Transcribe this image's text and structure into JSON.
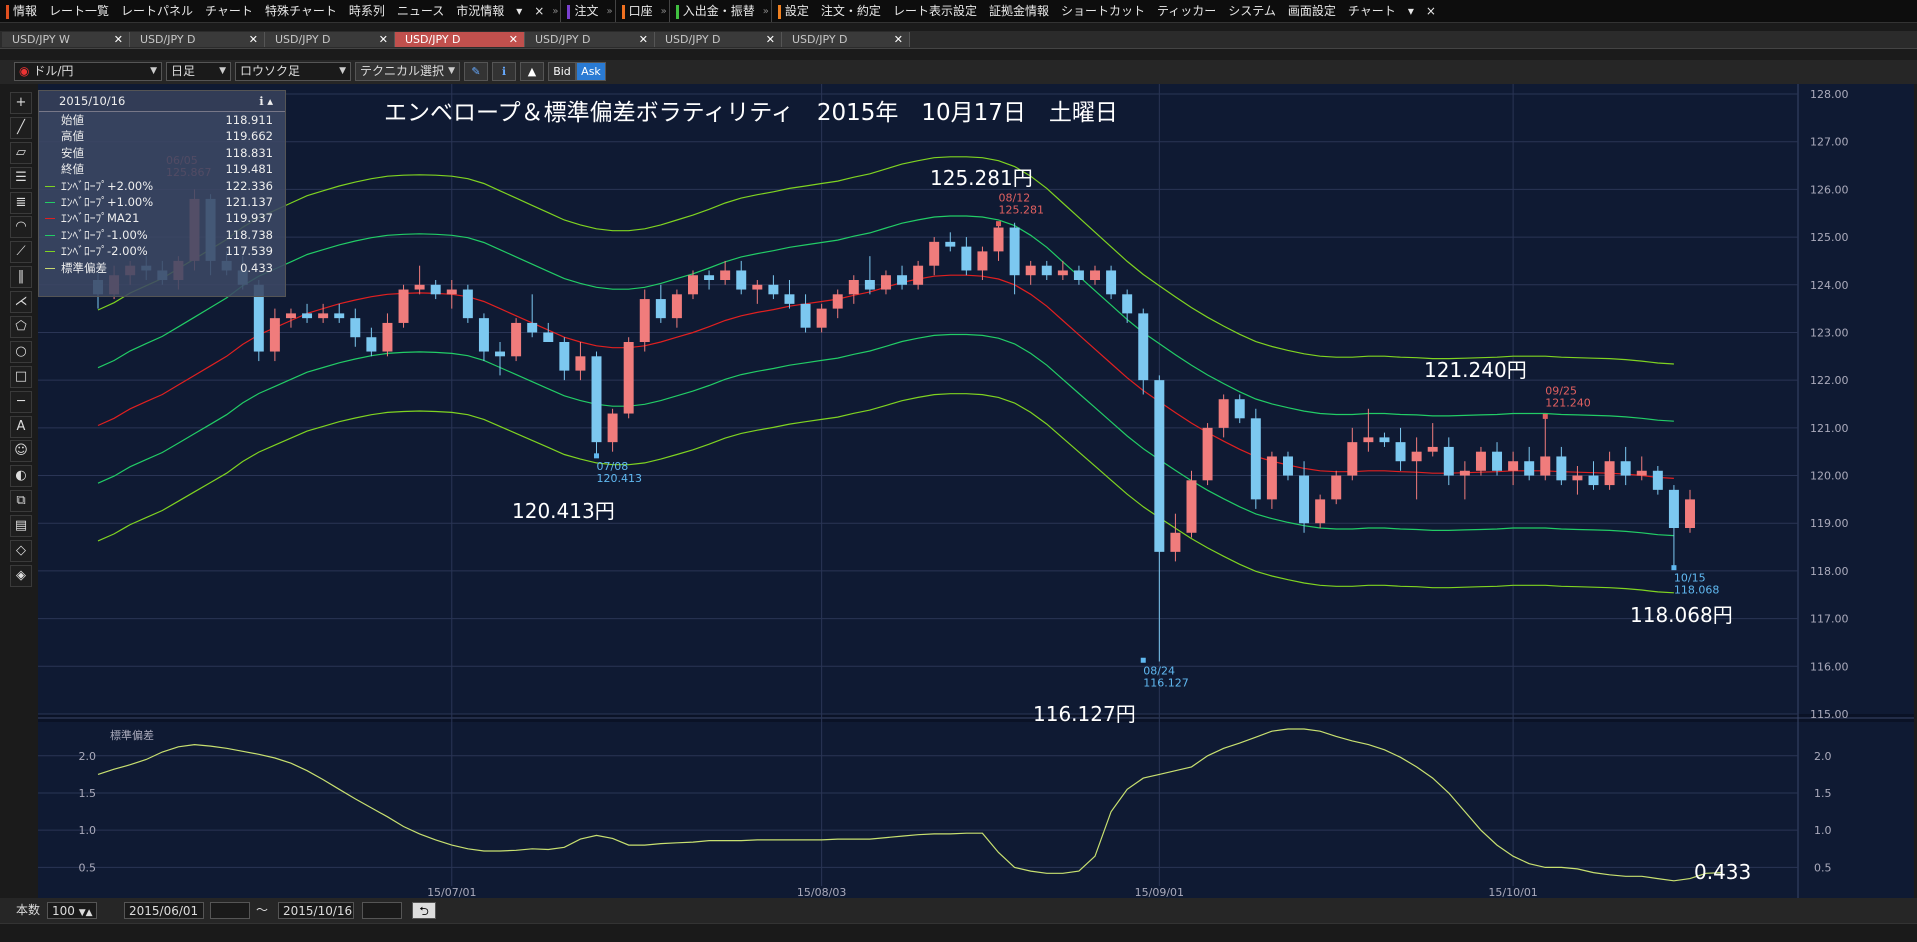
{
  "menu": {
    "items_a": [
      "情報",
      "レート一覧",
      "レートパネル",
      "チャート",
      "特殊チャート",
      "時系列",
      "ニュース",
      "市況情報"
    ],
    "order": "注文",
    "account": "口座",
    "deposit": "入出金・振替",
    "items_b": [
      "設定",
      "注文・約定",
      "レート表示設定",
      "証拠金情報",
      "ショートカット",
      "ティッカー",
      "システム",
      "画面設定",
      "チャート"
    ],
    "close": "×"
  },
  "tabs": [
    {
      "label": "USD/JPY W",
      "active": false
    },
    {
      "label": "USD/JPY D",
      "active": false
    },
    {
      "label": "USD/JPY D",
      "active": false
    },
    {
      "label": "USD/JPY D",
      "active": true
    },
    {
      "label": "USD/JPY D",
      "active": false
    },
    {
      "label": "USD/JPY D",
      "active": false
    },
    {
      "label": "USD/JPY D",
      "active": false
    }
  ],
  "toolbar": {
    "pair": "ドル/円",
    "period": "日足",
    "style": "ロウソク足",
    "technical": "テクニカル選択",
    "bid": "Bid",
    "ask": "Ask"
  },
  "info": {
    "date": "2015/10/16",
    "rows": [
      {
        "label": "始値",
        "value": "118.911",
        "color": ""
      },
      {
        "label": "高値",
        "value": "119.662",
        "color": ""
      },
      {
        "label": "安値",
        "value": "118.831",
        "color": ""
      },
      {
        "label": "終値",
        "value": "119.481",
        "color": ""
      },
      {
        "label": "ｴﾝﾍﾞﾛｰﾌﾟ+2.00%",
        "value": "122.336",
        "color": "#7fd321"
      },
      {
        "label": "ｴﾝﾍﾞﾛｰﾌﾟ+1.00%",
        "value": "121.137",
        "color": "#22cc66"
      },
      {
        "label": "ｴﾝﾍﾞﾛｰﾌﾟMA21",
        "value": "119.937",
        "color": "#e02020"
      },
      {
        "label": "ｴﾝﾍﾞﾛｰﾌﾟ-1.00%",
        "value": "118.738",
        "color": "#22cc66"
      },
      {
        "label": "ｴﾝﾍﾞﾛｰﾌﾟ-2.00%",
        "value": "117.539",
        "color": "#7fd321"
      },
      {
        "label": "標準偏差",
        "value": "0.433",
        "color": "#c8d870"
      }
    ]
  },
  "bottom": {
    "count_label": "本数",
    "count": "100",
    "from": "2015/06/01",
    "tilde": "～",
    "to": "2015/10/16"
  },
  "chart_data": {
    "type": "candlestick",
    "title": "エンベロープ＆標準偏差ボラティリティ　2015年　10月17日　土曜日",
    "ylim": [
      115,
      128
    ],
    "y_ticks": [
      "128.00",
      "127.00",
      "126.00",
      "125.00",
      "124.00",
      "123.00",
      "122.00",
      "121.00",
      "120.00",
      "119.00",
      "118.00",
      "117.00",
      "116.00",
      "115.00"
    ],
    "x_ticks": [
      "15/07/01",
      "15/08/03",
      "15/09/01",
      "15/10/01"
    ],
    "annotations": [
      {
        "text": "125.281円",
        "small_date": "08/12",
        "small_val": "125.281",
        "color": "#e06060"
      },
      {
        "text": "120.413円",
        "small_date": "07/08",
        "small_val": "120.413",
        "color": "#60b8f0"
      },
      {
        "text": "116.127円",
        "small_date": "08/24",
        "small_val": "116.127",
        "color": "#60b8f0"
      },
      {
        "text": "121.240円",
        "small_date": "09/25",
        "small_val": "121.240",
        "color": "#e06060"
      },
      {
        "text": "118.068円",
        "small_date": "10/15",
        "small_val": "118.068",
        "color": "#60b8f0"
      },
      {
        "text": "0.433",
        "small_date": "",
        "small_val": "",
        "color": "#ffffff"
      }
    ],
    "partial_label": {
      "date": "06/05",
      "val": "125.867"
    },
    "sub_title": "標準偏差",
    "sub_ylim": [
      0.25,
      2.4
    ],
    "sub_ticks": [
      "2.0",
      "1.5",
      "1.0",
      "0.5"
    ],
    "ma21": [
      121.05,
      121.2,
      121.4,
      121.55,
      121.7,
      121.9,
      122.1,
      122.3,
      122.5,
      122.75,
      122.95,
      123.1,
      123.25,
      123.4,
      123.5,
      123.6,
      123.68,
      123.75,
      123.8,
      123.82,
      123.83,
      123.82,
      123.8,
      123.75,
      123.65,
      123.5,
      123.35,
      123.2,
      123.05,
      122.9,
      122.8,
      122.72,
      122.68,
      122.68,
      122.72,
      122.8,
      122.9,
      123.0,
      123.12,
      123.25,
      123.35,
      123.42,
      123.48,
      123.55,
      123.6,
      123.65,
      123.7,
      123.78,
      123.85,
      123.95,
      124.05,
      124.12,
      124.18,
      124.2,
      124.2,
      124.18,
      124.12,
      124.0,
      123.8,
      123.55,
      123.25,
      122.95,
      122.65,
      122.35,
      122.05,
      121.78,
      121.55,
      121.32,
      121.1,
      120.9,
      120.72,
      120.55,
      120.4,
      120.3,
      120.22,
      120.15,
      120.1,
      120.08,
      120.08,
      120.1,
      120.1,
      120.08,
      120.07,
      120.05,
      120.05,
      120.06,
      120.07,
      120.08,
      120.1,
      120.1,
      120.1,
      120.08,
      120.07,
      120.06,
      120.05,
      120.03,
      120.0,
      119.96,
      119.94
    ],
    "std": [
      1.75,
      1.82,
      1.88,
      1.95,
      2.05,
      2.12,
      2.15,
      2.13,
      2.1,
      2.06,
      2.02,
      1.97,
      1.9,
      1.8,
      1.68,
      1.55,
      1.42,
      1.3,
      1.18,
      1.05,
      0.95,
      0.87,
      0.8,
      0.75,
      0.72,
      0.72,
      0.73,
      0.75,
      0.74,
      0.77,
      0.88,
      0.93,
      0.89,
      0.8,
      0.8,
      0.82,
      0.83,
      0.84,
      0.86,
      0.86,
      0.86,
      0.87,
      0.87,
      0.87,
      0.87,
      0.87,
      0.88,
      0.88,
      0.88,
      0.9,
      0.92,
      0.94,
      0.95,
      0.95,
      0.96,
      0.96,
      0.7,
      0.5,
      0.45,
      0.42,
      0.42,
      0.45,
      0.65,
      1.25,
      1.55,
      1.7,
      1.75,
      1.8,
      1.85,
      2.0,
      2.1,
      2.17,
      2.25,
      2.33,
      2.36,
      2.36,
      2.33,
      2.26,
      2.2,
      2.15,
      2.08,
      1.98,
      1.85,
      1.7,
      1.5,
      1.25,
      1.0,
      0.8,
      0.65,
      0.55,
      0.5,
      0.5,
      0.48,
      0.43,
      0.4,
      0.38,
      0.38,
      0.35,
      0.32,
      0.35,
      0.42,
      0.43
    ],
    "candles": [
      {
        "o": 124.1,
        "h": 124.3,
        "l": 123.5,
        "c": 123.8
      },
      {
        "o": 123.8,
        "h": 124.4,
        "l": 123.7,
        "c": 124.2
      },
      {
        "o": 124.2,
        "h": 124.5,
        "l": 124.0,
        "c": 124.4
      },
      {
        "o": 124.4,
        "h": 124.6,
        "l": 124.1,
        "c": 124.3
      },
      {
        "o": 124.3,
        "h": 124.5,
        "l": 124.0,
        "c": 124.1
      },
      {
        "o": 124.1,
        "h": 124.6,
        "l": 123.9,
        "c": 124.5
      },
      {
        "o": 124.5,
        "h": 126.0,
        "l": 124.3,
        "c": 125.8
      },
      {
        "o": 125.8,
        "h": 125.9,
        "l": 124.2,
        "c": 124.5
      },
      {
        "o": 124.5,
        "h": 124.7,
        "l": 124.2,
        "c": 124.3
      },
      {
        "o": 124.3,
        "h": 124.6,
        "l": 123.9,
        "c": 124.0
      },
      {
        "o": 124.0,
        "h": 124.1,
        "l": 122.4,
        "c": 122.6
      },
      {
        "o": 122.6,
        "h": 123.5,
        "l": 122.4,
        "c": 123.3
      },
      {
        "o": 123.3,
        "h": 123.5,
        "l": 123.1,
        "c": 123.4
      },
      {
        "o": 123.4,
        "h": 123.6,
        "l": 123.2,
        "c": 123.3
      },
      {
        "o": 123.3,
        "h": 123.6,
        "l": 123.2,
        "c": 123.4
      },
      {
        "o": 123.4,
        "h": 123.6,
        "l": 123.2,
        "c": 123.3
      },
      {
        "o": 123.3,
        "h": 123.5,
        "l": 122.7,
        "c": 122.9
      },
      {
        "o": 122.9,
        "h": 123.1,
        "l": 122.5,
        "c": 122.6
      },
      {
        "o": 122.6,
        "h": 123.4,
        "l": 122.5,
        "c": 123.2
      },
      {
        "o": 123.2,
        "h": 124.0,
        "l": 123.1,
        "c": 123.9
      },
      {
        "o": 123.9,
        "h": 124.4,
        "l": 123.8,
        "c": 124.0
      },
      {
        "o": 124.0,
        "h": 124.1,
        "l": 123.7,
        "c": 123.8
      },
      {
        "o": 123.8,
        "h": 124.1,
        "l": 123.5,
        "c": 123.9
      },
      {
        "o": 123.9,
        "h": 124.0,
        "l": 123.2,
        "c": 123.3
      },
      {
        "o": 123.3,
        "h": 123.4,
        "l": 122.4,
        "c": 122.6
      },
      {
        "o": 122.6,
        "h": 122.8,
        "l": 122.1,
        "c": 122.5
      },
      {
        "o": 122.5,
        "h": 123.3,
        "l": 122.4,
        "c": 123.2
      },
      {
        "o": 123.2,
        "h": 123.8,
        "l": 122.9,
        "c": 123.0
      },
      {
        "o": 123.0,
        "h": 123.2,
        "l": 122.8,
        "c": 122.8
      },
      {
        "o": 122.8,
        "h": 122.9,
        "l": 122.0,
        "c": 122.2
      },
      {
        "o": 122.2,
        "h": 122.8,
        "l": 122.0,
        "c": 122.5
      },
      {
        "o": 122.5,
        "h": 122.6,
        "l": 120.4,
        "c": 120.7
      },
      {
        "o": 120.7,
        "h": 121.4,
        "l": 120.5,
        "c": 121.3
      },
      {
        "o": 121.3,
        "h": 122.9,
        "l": 121.2,
        "c": 122.8
      },
      {
        "o": 122.8,
        "h": 123.9,
        "l": 122.6,
        "c": 123.7
      },
      {
        "o": 123.7,
        "h": 124.0,
        "l": 123.2,
        "c": 123.3
      },
      {
        "o": 123.3,
        "h": 123.9,
        "l": 123.1,
        "c": 123.8
      },
      {
        "o": 123.8,
        "h": 124.3,
        "l": 123.7,
        "c": 124.2
      },
      {
        "o": 124.2,
        "h": 124.3,
        "l": 123.9,
        "c": 124.1
      },
      {
        "o": 124.1,
        "h": 124.5,
        "l": 124.0,
        "c": 124.3
      },
      {
        "o": 124.3,
        "h": 124.5,
        "l": 123.8,
        "c": 123.9
      },
      {
        "o": 123.9,
        "h": 124.1,
        "l": 123.6,
        "c": 124.0
      },
      {
        "o": 124.0,
        "h": 124.2,
        "l": 123.7,
        "c": 123.8
      },
      {
        "o": 123.8,
        "h": 124.1,
        "l": 123.5,
        "c": 123.6
      },
      {
        "o": 123.6,
        "h": 123.8,
        "l": 123.0,
        "c": 123.1
      },
      {
        "o": 123.1,
        "h": 123.6,
        "l": 123.0,
        "c": 123.5
      },
      {
        "o": 123.5,
        "h": 123.9,
        "l": 123.3,
        "c": 123.8
      },
      {
        "o": 123.8,
        "h": 124.2,
        "l": 123.6,
        "c": 124.1
      },
      {
        "o": 124.1,
        "h": 124.6,
        "l": 123.8,
        "c": 123.9
      },
      {
        "o": 123.9,
        "h": 124.3,
        "l": 123.8,
        "c": 124.2
      },
      {
        "o": 124.2,
        "h": 124.4,
        "l": 123.9,
        "c": 124.0
      },
      {
        "o": 124.0,
        "h": 124.5,
        "l": 123.9,
        "c": 124.4
      },
      {
        "o": 124.4,
        "h": 125.0,
        "l": 124.2,
        "c": 124.9
      },
      {
        "o": 124.9,
        "h": 125.1,
        "l": 124.7,
        "c": 124.8
      },
      {
        "o": 124.8,
        "h": 125.0,
        "l": 124.2,
        "c": 124.3
      },
      {
        "o": 124.3,
        "h": 124.8,
        "l": 124.1,
        "c": 124.7
      },
      {
        "o": 124.7,
        "h": 125.3,
        "l": 124.5,
        "c": 125.2
      },
      {
        "o": 125.2,
        "h": 125.3,
        "l": 123.8,
        "c": 124.2
      },
      {
        "o": 124.2,
        "h": 124.5,
        "l": 124.0,
        "c": 124.4
      },
      {
        "o": 124.4,
        "h": 124.5,
        "l": 124.1,
        "c": 124.2
      },
      {
        "o": 124.2,
        "h": 124.5,
        "l": 124.1,
        "c": 124.3
      },
      {
        "o": 124.3,
        "h": 124.4,
        "l": 124.0,
        "c": 124.1
      },
      {
        "o": 124.1,
        "h": 124.4,
        "l": 124.0,
        "c": 124.3
      },
      {
        "o": 124.3,
        "h": 124.4,
        "l": 123.7,
        "c": 123.8
      },
      {
        "o": 123.8,
        "h": 123.9,
        "l": 123.2,
        "c": 123.4
      },
      {
        "o": 123.4,
        "h": 123.5,
        "l": 121.7,
        "c": 122.0
      },
      {
        "o": 122.0,
        "h": 122.1,
        "l": 116.1,
        "c": 118.4
      },
      {
        "o": 118.4,
        "h": 119.2,
        "l": 118.2,
        "c": 118.8
      },
      {
        "o": 118.8,
        "h": 120.1,
        "l": 118.7,
        "c": 119.9
      },
      {
        "o": 119.9,
        "h": 121.1,
        "l": 119.8,
        "c": 121.0
      },
      {
        "o": 121.0,
        "h": 121.7,
        "l": 120.8,
        "c": 121.6
      },
      {
        "o": 121.6,
        "h": 121.7,
        "l": 121.1,
        "c": 121.2
      },
      {
        "o": 121.2,
        "h": 121.4,
        "l": 119.3,
        "c": 119.5
      },
      {
        "o": 119.5,
        "h": 120.5,
        "l": 119.3,
        "c": 120.4
      },
      {
        "o": 120.4,
        "h": 120.5,
        "l": 119.9,
        "c": 120.0
      },
      {
        "o": 120.0,
        "h": 120.3,
        "l": 118.8,
        "c": 119.0
      },
      {
        "o": 119.0,
        "h": 119.6,
        "l": 118.9,
        "c": 119.5
      },
      {
        "o": 119.5,
        "h": 120.1,
        "l": 119.4,
        "c": 120.0
      },
      {
        "o": 120.0,
        "h": 121.0,
        "l": 119.9,
        "c": 120.7
      },
      {
        "o": 120.7,
        "h": 121.4,
        "l": 120.5,
        "c": 120.8
      },
      {
        "o": 120.8,
        "h": 120.9,
        "l": 120.6,
        "c": 120.7
      },
      {
        "o": 120.7,
        "h": 121.0,
        "l": 120.1,
        "c": 120.3
      },
      {
        "o": 120.3,
        "h": 120.8,
        "l": 119.5,
        "c": 120.5
      },
      {
        "o": 120.5,
        "h": 121.1,
        "l": 120.4,
        "c": 120.6
      },
      {
        "o": 120.6,
        "h": 120.8,
        "l": 119.8,
        "c": 120.0
      },
      {
        "o": 120.0,
        "h": 120.3,
        "l": 119.5,
        "c": 120.1
      },
      {
        "o": 120.1,
        "h": 120.6,
        "l": 120.0,
        "c": 120.5
      },
      {
        "o": 120.5,
        "h": 120.7,
        "l": 120.0,
        "c": 120.1
      },
      {
        "o": 120.1,
        "h": 120.5,
        "l": 119.8,
        "c": 120.3
      },
      {
        "o": 120.3,
        "h": 120.6,
        "l": 119.9,
        "c": 120.0
      },
      {
        "o": 120.0,
        "h": 121.2,
        "l": 119.9,
        "c": 120.4
      },
      {
        "o": 120.4,
        "h": 120.6,
        "l": 119.8,
        "c": 119.9
      },
      {
        "o": 119.9,
        "h": 120.2,
        "l": 119.6,
        "c": 120.0
      },
      {
        "o": 120.0,
        "h": 120.3,
        "l": 119.7,
        "c": 119.8
      },
      {
        "o": 119.8,
        "h": 120.5,
        "l": 119.7,
        "c": 120.3
      },
      {
        "o": 120.3,
        "h": 120.6,
        "l": 119.8,
        "c": 120.0
      },
      {
        "o": 120.0,
        "h": 120.4,
        "l": 119.9,
        "c": 120.1
      },
      {
        "o": 120.1,
        "h": 120.2,
        "l": 119.6,
        "c": 119.7
      },
      {
        "o": 119.7,
        "h": 119.8,
        "l": 118.1,
        "c": 118.9
      },
      {
        "o": 118.9,
        "h": 119.7,
        "l": 118.8,
        "c": 119.5
      }
    ]
  }
}
